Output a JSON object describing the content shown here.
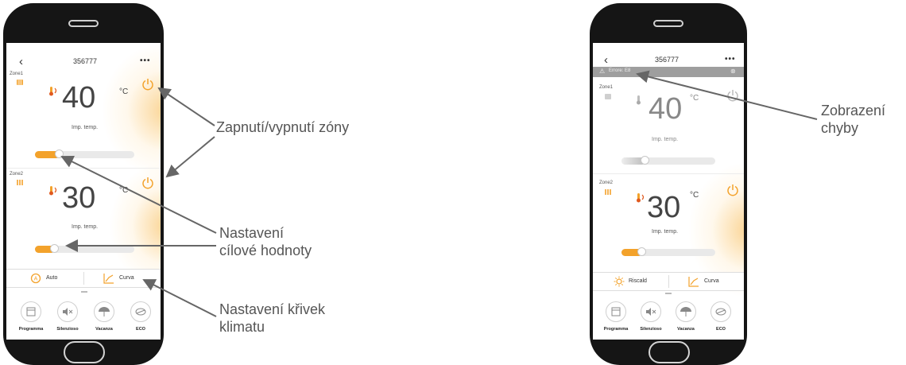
{
  "left_phone": {
    "title": "356777",
    "back": "‹",
    "more": "•••",
    "zone1": {
      "label": "Zone1",
      "temp": "40",
      "unit": "°C",
      "caption": "Imp. temp.",
      "slider_value": 0.25
    },
    "zone2": {
      "label": "Zone2",
      "temp": "30",
      "unit": "°C",
      "caption": "Imp. temp.",
      "slider_value": 0.2
    },
    "mode_tab": {
      "label": "Auto",
      "icon": "auto-mode-icon"
    },
    "curve_tab": {
      "label": "Curva",
      "icon": "curve-chart-icon"
    },
    "nav": [
      {
        "label": "Programma",
        "icon": "calendar-icon"
      },
      {
        "label": "Silenzioso",
        "icon": "mute-icon"
      },
      {
        "label": "Vacanza",
        "icon": "umbrella-icon"
      },
      {
        "label": "ECO",
        "icon": "leaf-icon"
      }
    ]
  },
  "right_phone": {
    "title": "356777",
    "back": "‹",
    "more": "•••",
    "error_text": "Errore: E8",
    "zone1": {
      "label": "Zone1",
      "temp": "40",
      "unit": "°C",
      "caption": "Imp. temp.",
      "slider_value": 0.25
    },
    "zone2": {
      "label": "Zone2",
      "temp": "30",
      "unit": "°C",
      "caption": "Imp. temp.",
      "slider_value": 0.22
    },
    "mode_tab": {
      "label": "Riscald",
      "icon": "sun-icon"
    },
    "curve_tab": {
      "label": "Curva",
      "icon": "curve-chart-icon"
    },
    "nav": [
      {
        "label": "Programma",
        "icon": "calendar-icon"
      },
      {
        "label": "Silenzioso",
        "icon": "mute-icon"
      },
      {
        "label": "Vacanza",
        "icon": "umbrella-icon"
      },
      {
        "label": "ECO",
        "icon": "leaf-icon"
      }
    ]
  },
  "callouts": {
    "zone_power": "Zapnutí/vypnutí zóny",
    "target_value_line1": "Nastavení",
    "target_value_line2": "cílové hodnoty",
    "climate_curves_line1": "Nastavení křivek",
    "climate_curves_line2": "klimatu",
    "error_line1": "Zobrazení",
    "error_line2": "chyby"
  },
  "colors": {
    "accent": "#f3a22b",
    "arrow": "#666666",
    "error_bar": "#9e9e9e"
  }
}
